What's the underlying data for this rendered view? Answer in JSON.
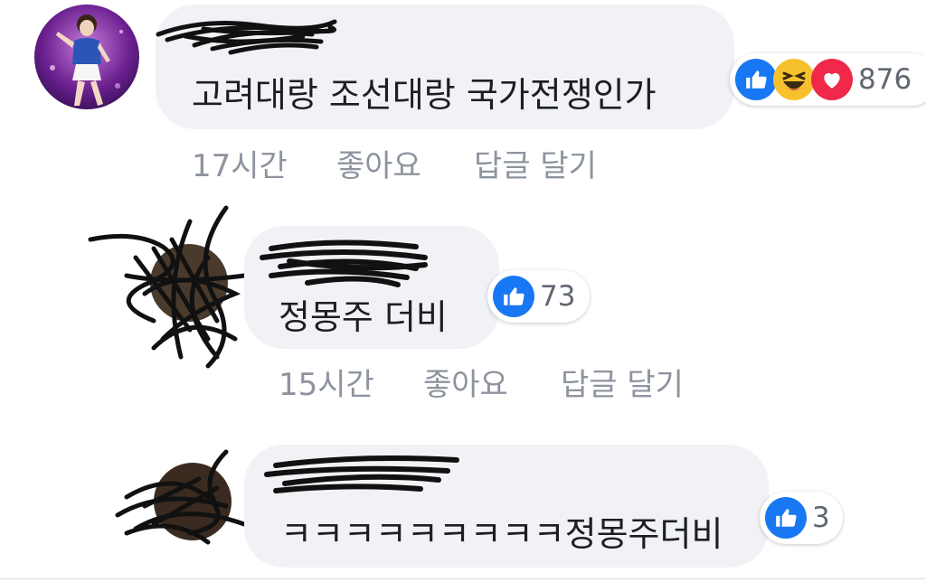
{
  "comments": [
    {
      "text": "고려대랑 조선대랑 국가전쟁인가",
      "time": "17시간",
      "like_label": "좋아요",
      "reply_label": "답글 달기",
      "reactions": [
        "like",
        "haha",
        "love"
      ],
      "reaction_count": "876"
    },
    {
      "text": "정몽주 더비",
      "time": "15시간",
      "like_label": "좋아요",
      "reply_label": "답글 달기",
      "reactions": [
        "like"
      ],
      "reaction_count": "73"
    },
    {
      "text": "ㅋㅋㅋㅋㅋㅋㅋㅋㅋ정몽주더비",
      "reactions": [
        "like"
      ],
      "reaction_count": "3"
    }
  ],
  "colors": {
    "like_blue": "#1877f2",
    "love_red": "#f0284a",
    "haha_yellow": "#f7c12e",
    "bubble_bg": "#f1f2f6",
    "meta_gray": "#8d949e"
  }
}
